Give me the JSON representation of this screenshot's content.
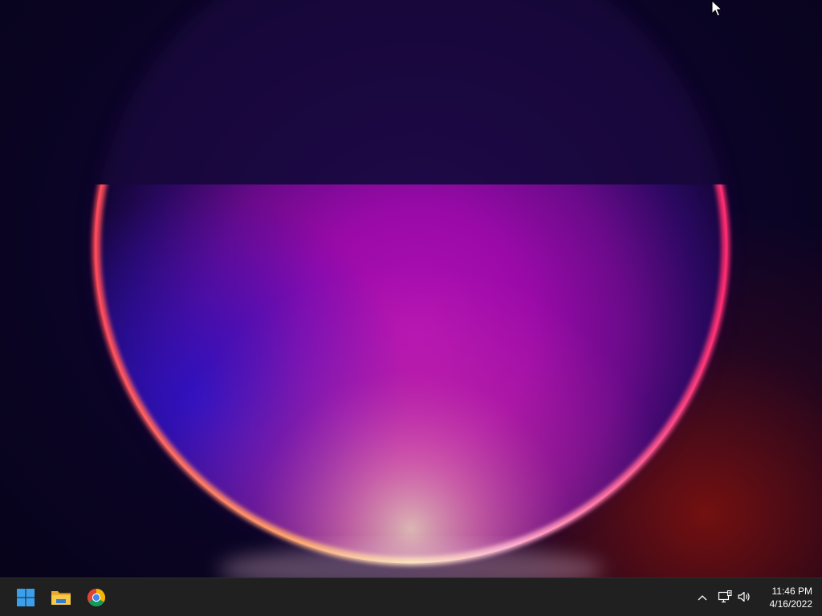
{
  "taskbar": {
    "pinned": [
      {
        "name": "Start",
        "icon": "windows-start-icon"
      },
      {
        "name": "File Explorer",
        "icon": "folder-icon"
      },
      {
        "name": "Google Chrome",
        "icon": "chrome-icon"
      }
    ],
    "tray": {
      "icons": [
        "chevron-up-icon",
        "network-icon",
        "volume-icon"
      ],
      "time": "11:46 PM",
      "date": "4/16/2022"
    }
  },
  "colors": {
    "taskbar_bg": "#202020",
    "start_blue": "#3aa0ee",
    "folder_yellow": "#f4c14a",
    "wallpaper_magenta": "#a40cb0",
    "wallpaper_rim": "#ff3a5a"
  }
}
